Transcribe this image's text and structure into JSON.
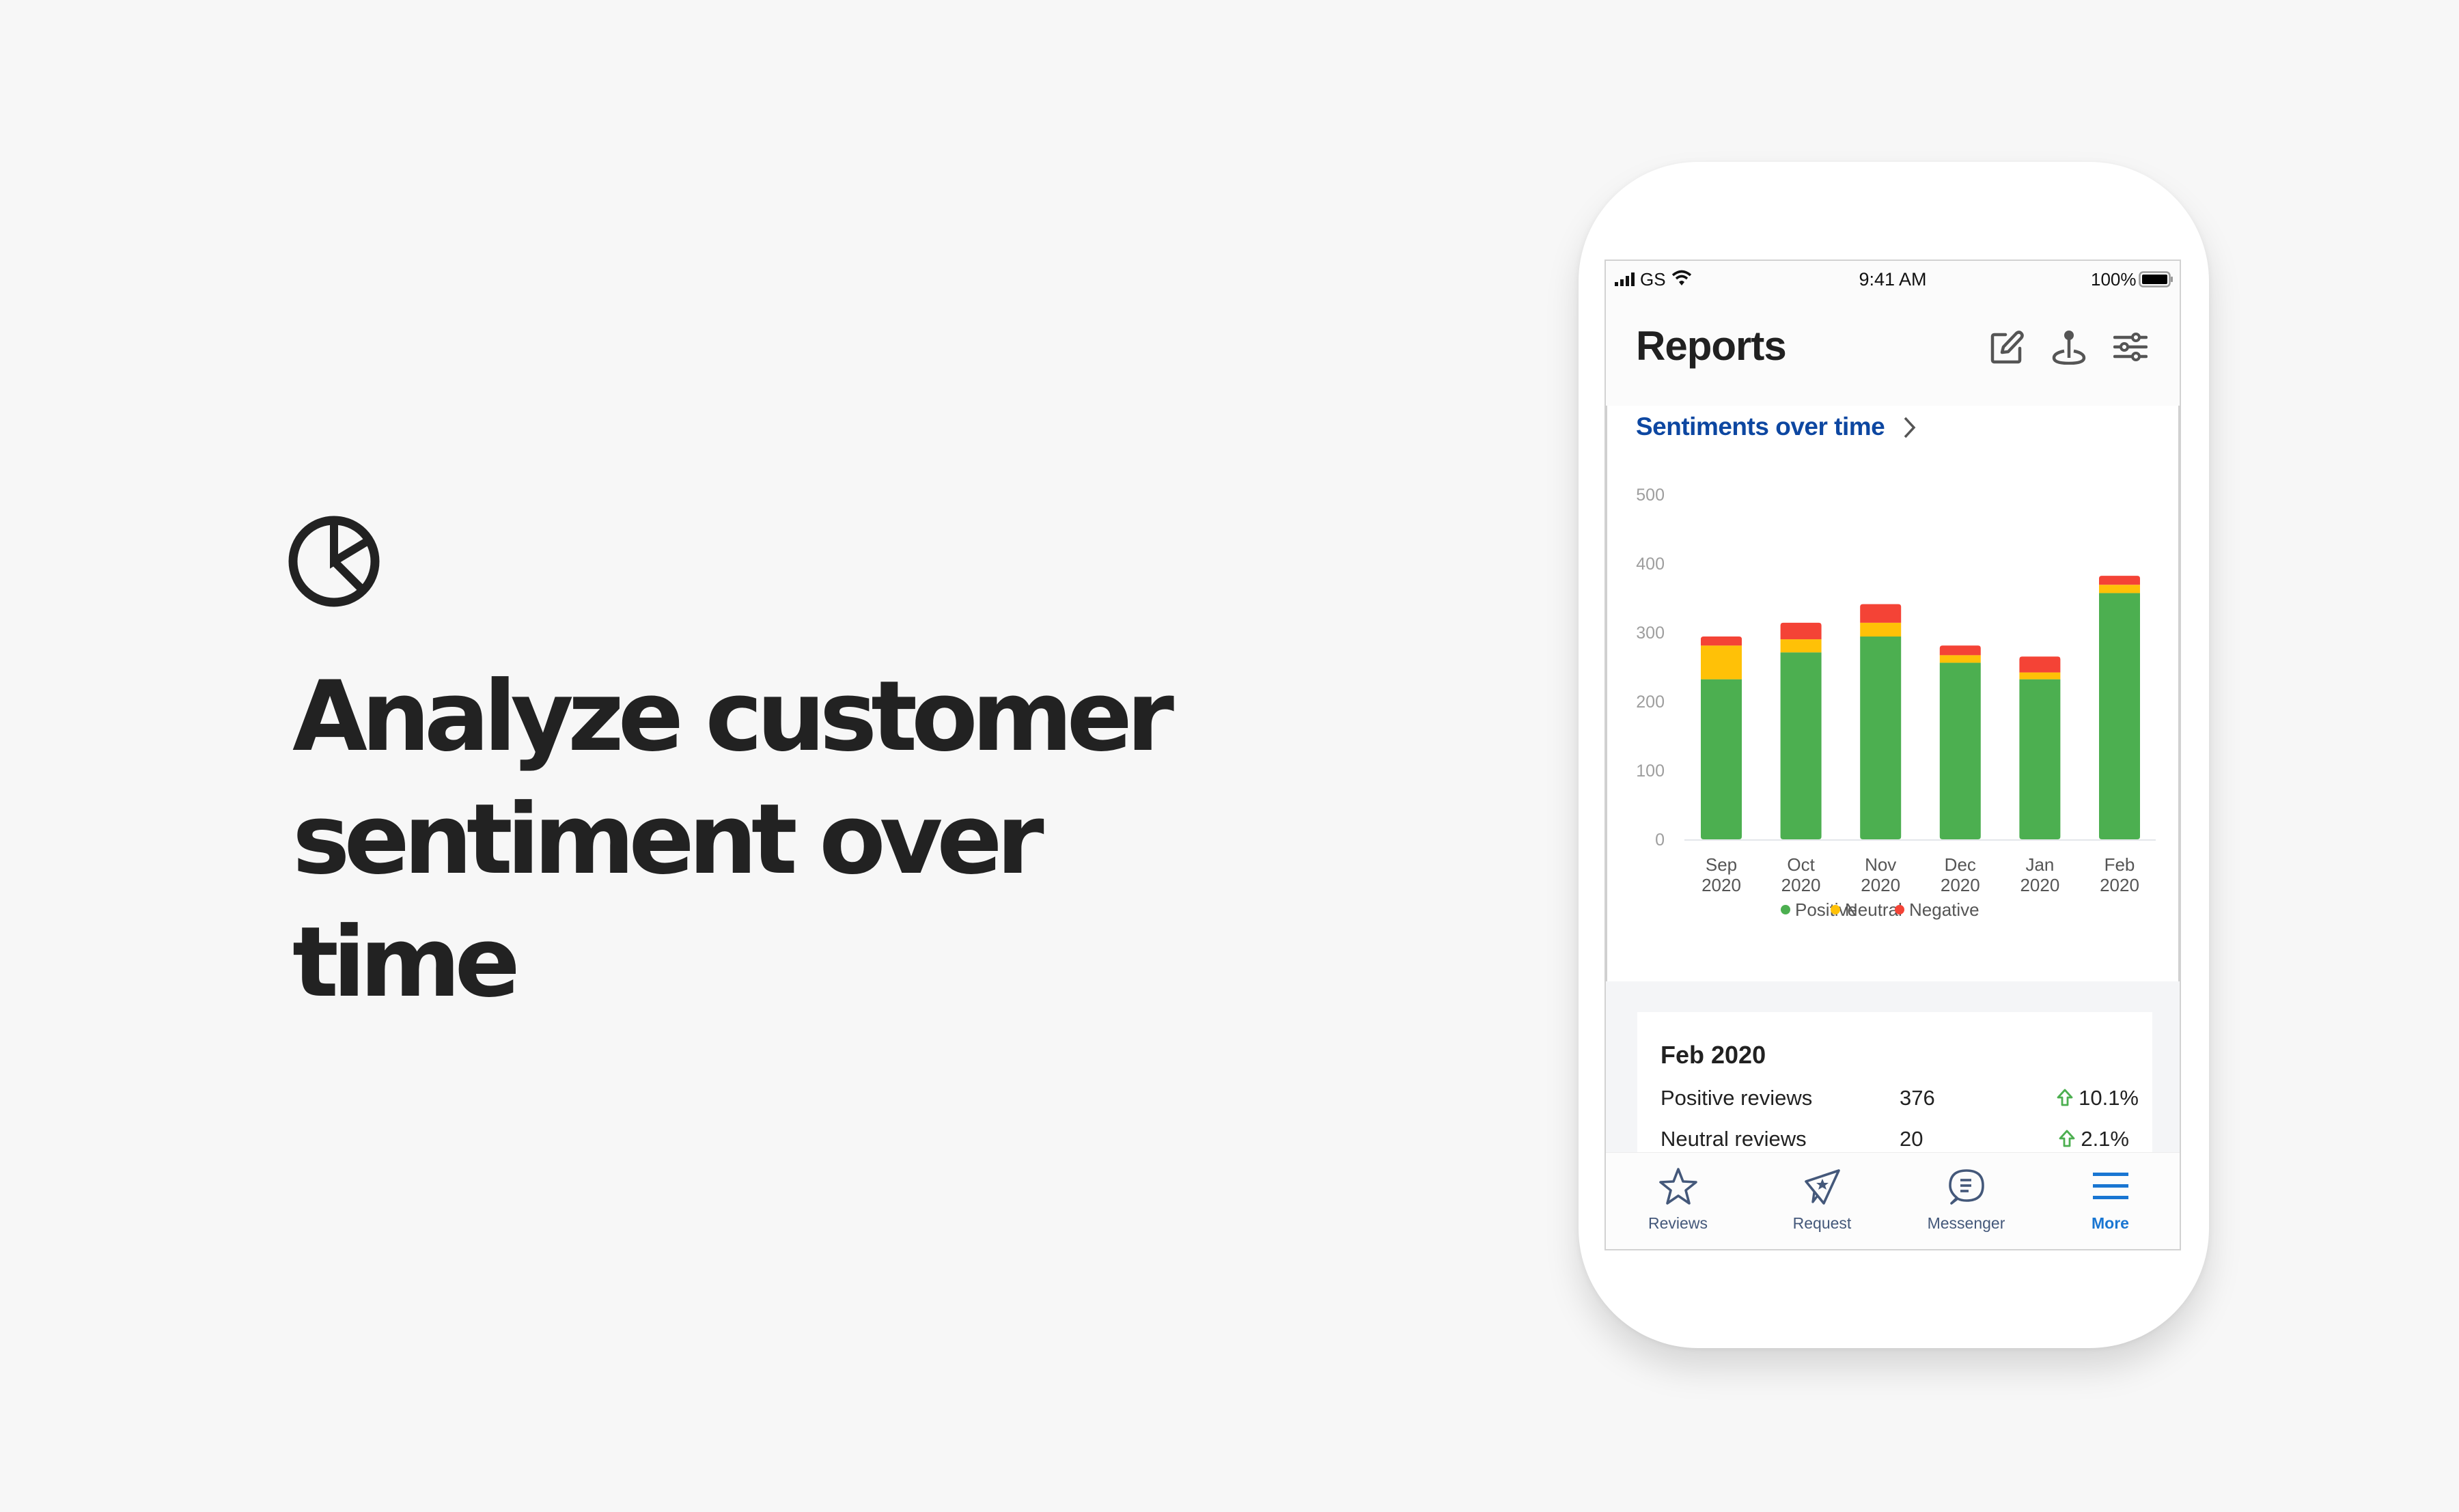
{
  "marketing": {
    "icon": "pie-chart-icon",
    "headline_line1": "Analyze customer",
    "headline_line2": "sentiment over time"
  },
  "status_bar": {
    "carrier": "GS",
    "time": "9:41 AM",
    "battery": "100%",
    "icons": [
      "signal-icon",
      "wifi-icon",
      "battery-icon"
    ]
  },
  "header": {
    "title": "Reports",
    "actions": [
      {
        "name": "edit",
        "icon": "edit-icon"
      },
      {
        "name": "location",
        "icon": "location-pin-icon"
      },
      {
        "name": "filters",
        "icon": "sliders-icon"
      }
    ]
  },
  "section": {
    "title": "Sentiments over time",
    "chevron": "chevron-right-icon"
  },
  "colors": {
    "positive": "#4CAF50",
    "neutral": "#FFC107",
    "negative": "#F44336",
    "accent": "#1976D2",
    "section_title": "#0D47A1",
    "trend_up": "#4CAF50"
  },
  "chart_data": {
    "type": "bar",
    "stacked": true,
    "title": "Sentiments over time",
    "xlabel": "",
    "ylabel": "",
    "ylim": [
      0,
      500
    ],
    "yticks": [
      0,
      100,
      200,
      300,
      400,
      500
    ],
    "grid": false,
    "categories": [
      [
        "Sep",
        "2020"
      ],
      [
        "Oct",
        "2020"
      ],
      [
        "Nov",
        "2020"
      ],
      [
        "Dec",
        "2020"
      ],
      [
        "Jan",
        "2020"
      ],
      [
        "Feb",
        "2020"
      ]
    ],
    "series": [
      {
        "name": "Positive",
        "color": "#4CAF50",
        "values": [
          232,
          271,
          294,
          256,
          232,
          357
        ]
      },
      {
        "name": "Neutral",
        "color": "#FFC107",
        "values": [
          49,
          19,
          20,
          11,
          10,
          12
        ]
      },
      {
        "name": "Negative",
        "color": "#F44336",
        "values": [
          13,
          24,
          27,
          14,
          23,
          13
        ]
      }
    ],
    "legend": {
      "position": "bottom",
      "entries": [
        "Positive",
        "Neutral",
        "Negative"
      ]
    }
  },
  "summary": {
    "title": "Feb 2020",
    "rows": [
      {
        "label": "Positive reviews",
        "value": "376",
        "change": "10.1%",
        "trend": "up"
      },
      {
        "label": "Neutral reviews",
        "value": "20",
        "change": "2.1%",
        "trend": "up"
      }
    ]
  },
  "tabbar": {
    "items": [
      {
        "label": "Reviews",
        "icon": "star-icon",
        "active": false
      },
      {
        "label": "Request",
        "icon": "paper-plane-star-icon",
        "active": false
      },
      {
        "label": "Messenger",
        "icon": "chat-bubble-icon",
        "active": false
      },
      {
        "label": "More",
        "icon": "menu-icon",
        "active": true
      }
    ]
  }
}
